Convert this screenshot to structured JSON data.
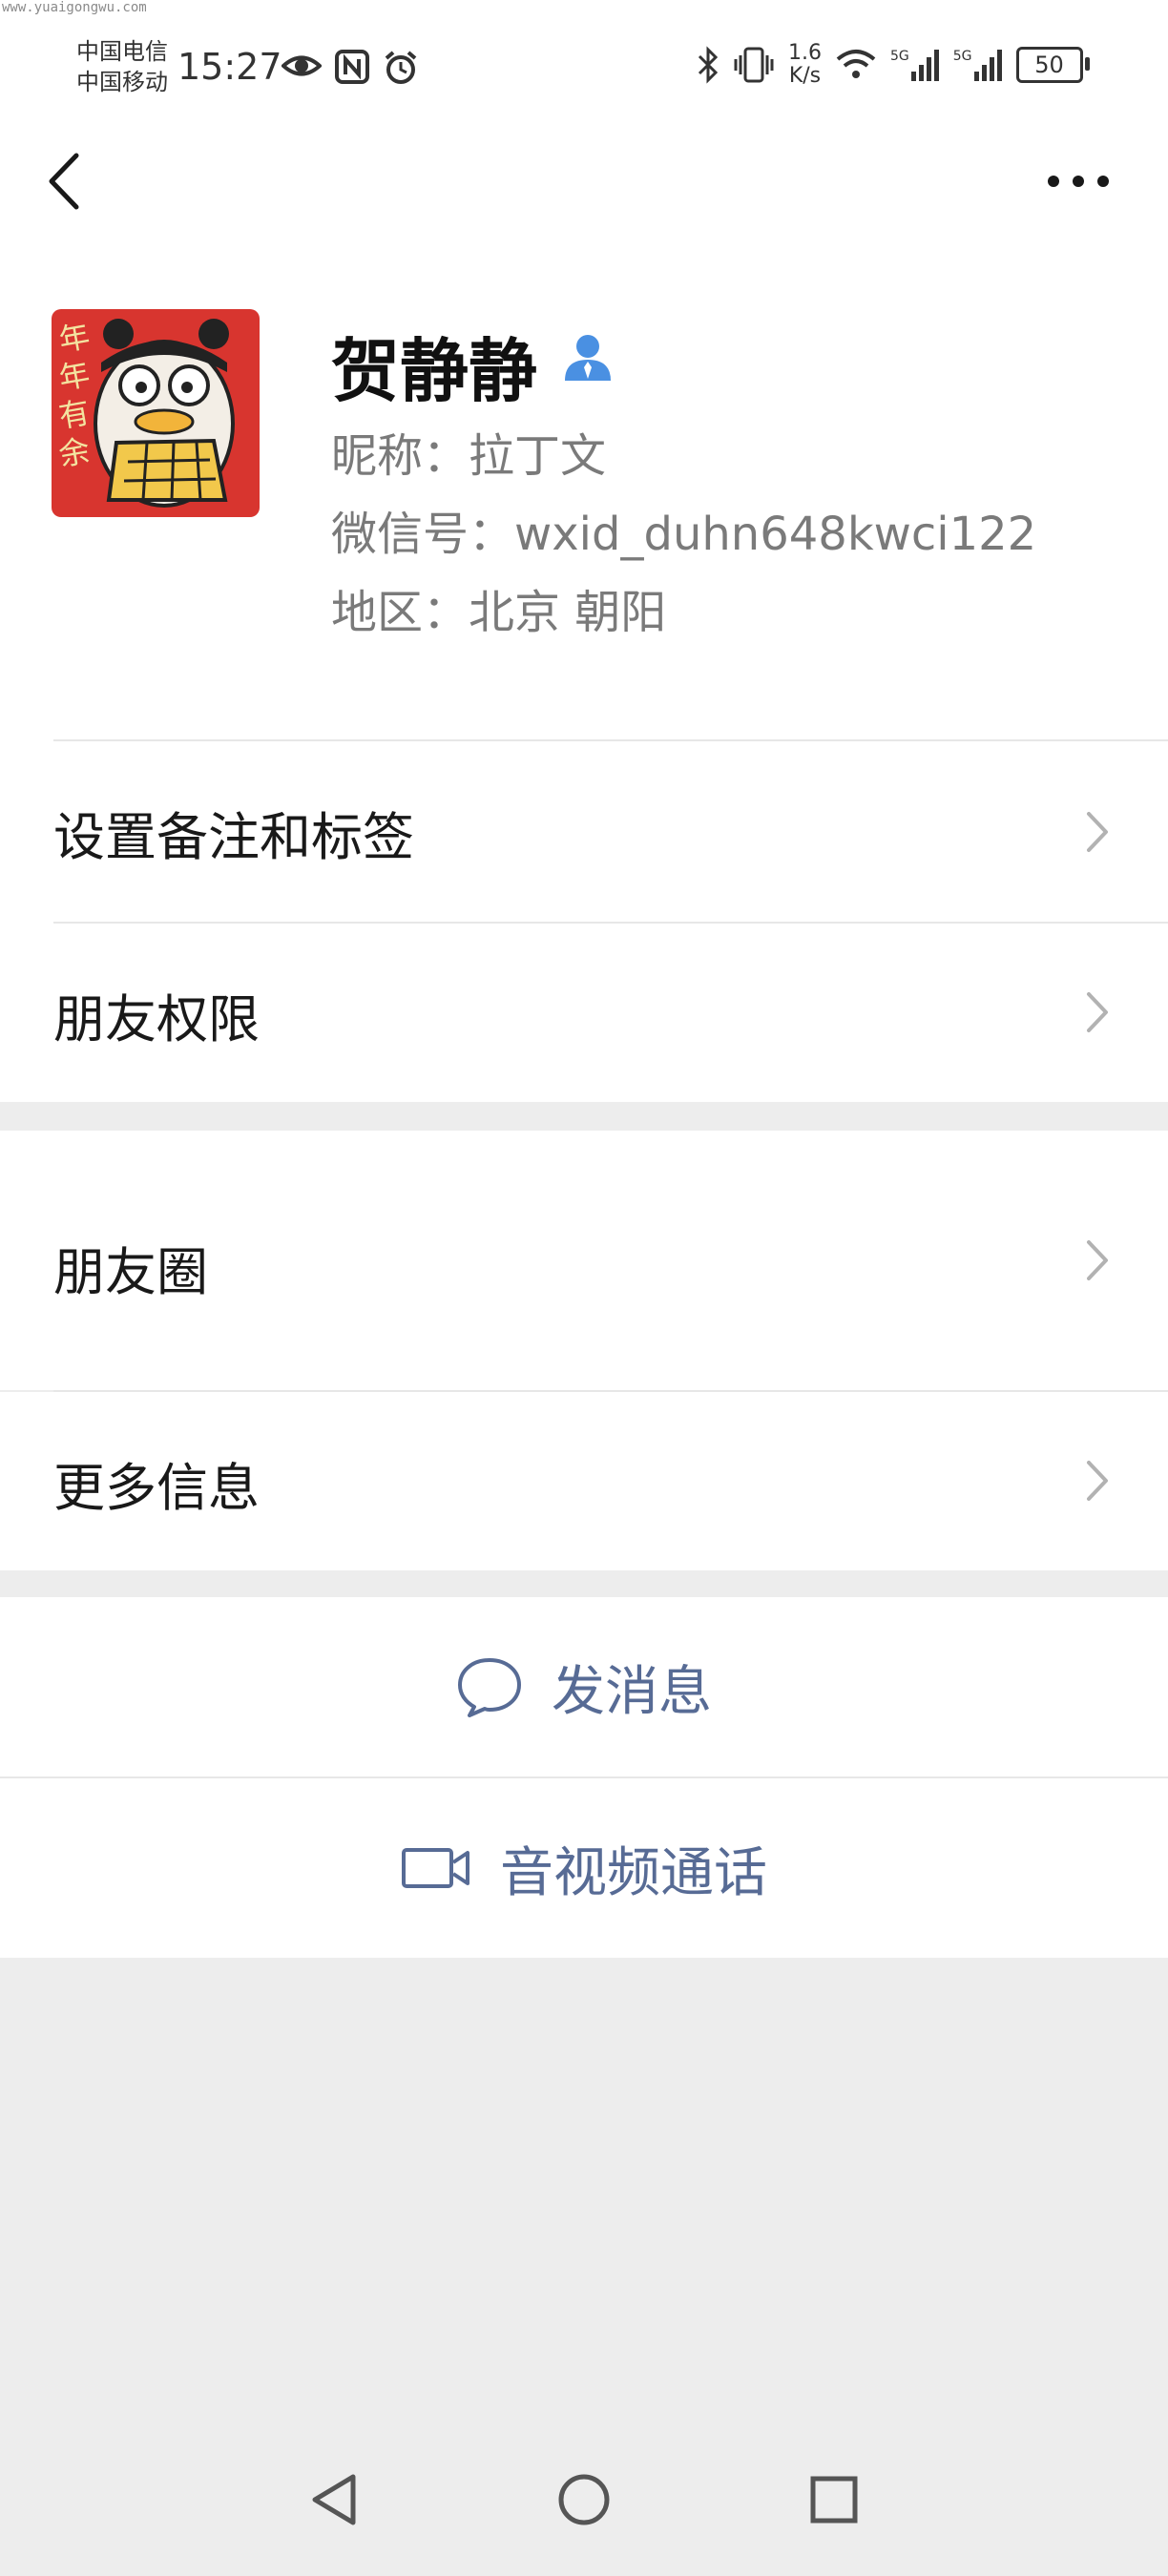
{
  "watermark": "www.yuaigongwu.com",
  "statusbar": {
    "carrier_1": "中国电信",
    "carrier_2": "中国移动",
    "time": "15:27",
    "speed_value": "1.6",
    "speed_unit": "K/s",
    "net_1": "5G",
    "net_2": "5G",
    "battery": "50",
    "icons": [
      "eye-icon",
      "nfc-icon",
      "alarm-icon",
      "bluetooth-icon",
      "vibrate-icon",
      "wifi-icon",
      "signal-icon"
    ]
  },
  "header": {
    "back_icon": "chevron-left-icon",
    "more_icon": "more-dots-icon"
  },
  "profile": {
    "name": "贺静静",
    "nickname": "昵称：拉丁文",
    "wechat_id": "微信号：wxid_duhn648kwci122",
    "region": "地区：北京  朝阳",
    "avatar_text": "年年有余"
  },
  "menu": {
    "remark_tags": "设置备注和标签",
    "friend_permissions": "朋友权限",
    "moments": "朋友圈",
    "more_info": "更多信息"
  },
  "actions": {
    "send_message": "发消息",
    "video_call": "音视频通话"
  },
  "colors": {
    "accent": "#576b95",
    "background": "#ededed",
    "person_badge": "#4a90e2"
  }
}
